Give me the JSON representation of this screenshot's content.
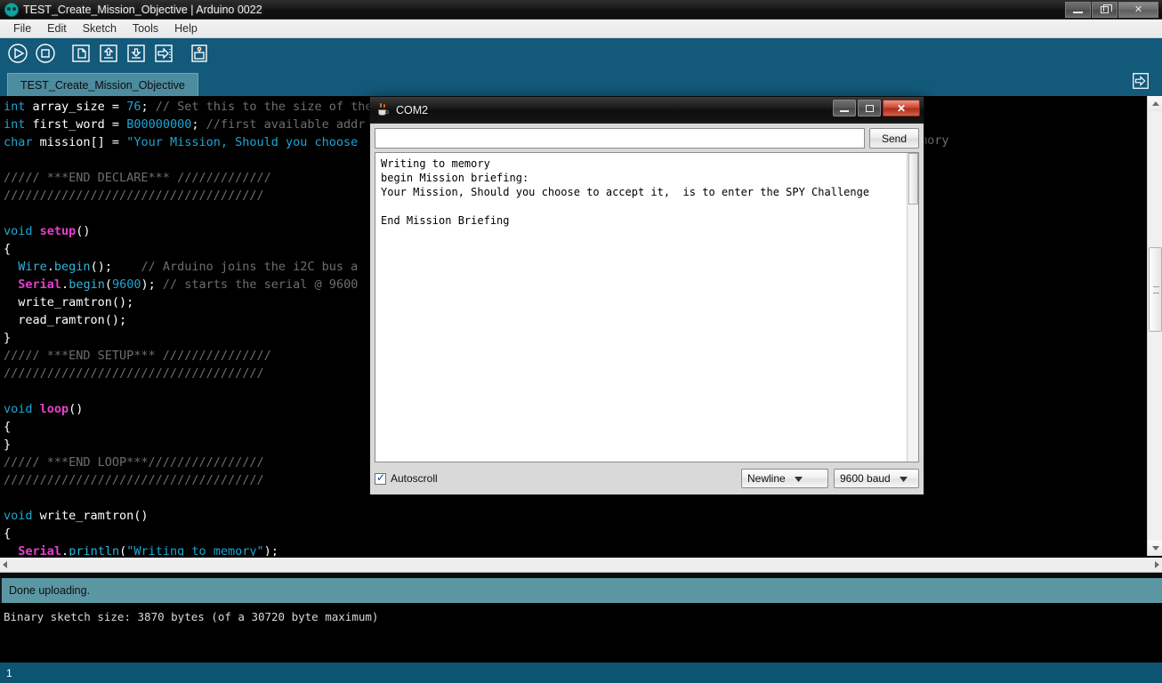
{
  "window": {
    "title": "TEST_Create_Mission_Objective | Arduino 0022",
    "icon": "arduino-logo-icon",
    "controls": {
      "minimize": "minimize-icon",
      "restore": "restore-icon",
      "close": "close-icon"
    }
  },
  "menubar": {
    "items": [
      {
        "label": "File"
      },
      {
        "label": "Edit"
      },
      {
        "label": "Sketch"
      },
      {
        "label": "Tools"
      },
      {
        "label": "Help"
      }
    ]
  },
  "toolbar": {
    "buttons": [
      {
        "name": "verify-button",
        "icon": "play-icon",
        "label": "Verify"
      },
      {
        "name": "stop-button",
        "icon": "stop-icon",
        "label": "Stop"
      },
      {
        "name": "new-button",
        "icon": "new-file-icon",
        "label": "New"
      },
      {
        "name": "open-button",
        "icon": "open-up-arrow-icon",
        "label": "Open"
      },
      {
        "name": "save-button",
        "icon": "save-down-arrow-icon",
        "label": "Save"
      },
      {
        "name": "upload-button",
        "icon": "upload-right-arrow-icon",
        "label": "Upload"
      },
      {
        "name": "serial-monitor-button",
        "icon": "serial-monitor-icon",
        "label": "Serial Monitor"
      }
    ],
    "tab_menu_icon": "tab-menu-arrow-icon"
  },
  "tabs": {
    "active": "TEST_Create_Mission_Objective"
  },
  "editor": {
    "lines": [
      {
        "tokens": [
          {
            "t": "int",
            "c": "kw"
          },
          {
            "t": " array_size = ",
            "c": "plain"
          },
          {
            "t": "76",
            "c": "num"
          },
          {
            "t": "; ",
            "c": "plain"
          },
          {
            "t": "// Set this to the size of the",
            "c": "cmt"
          }
        ]
      },
      {
        "tokens": [
          {
            "t": "int",
            "c": "kw"
          },
          {
            "t": " first_word = ",
            "c": "plain"
          },
          {
            "t": "B00000000",
            "c": "num"
          },
          {
            "t": "; ",
            "c": "plain"
          },
          {
            "t": "//first available addr",
            "c": "cmt"
          }
        ]
      },
      {
        "tokens": [
          {
            "t": "char",
            "c": "kw"
          },
          {
            "t": " mission[] = ",
            "c": "plain"
          },
          {
            "t": "\"Your Mission, Should you choose",
            "c": "str"
          }
        ]
      },
      {
        "tokens": []
      },
      {
        "tokens": [
          {
            "t": "///// ***END DECLARE*** /////////////",
            "c": "cmt"
          }
        ]
      },
      {
        "tokens": [
          {
            "t": "////////////////////////////////////",
            "c": "cmt"
          }
        ]
      },
      {
        "tokens": []
      },
      {
        "tokens": [
          {
            "t": "void",
            "c": "kw"
          },
          {
            "t": " ",
            "c": "plain"
          },
          {
            "t": "setup",
            "c": "fn"
          },
          {
            "t": "()",
            "c": "plain"
          }
        ]
      },
      {
        "tokens": [
          {
            "t": "{",
            "c": "plain"
          }
        ]
      },
      {
        "tokens": [
          {
            "t": "  ",
            "c": "plain"
          },
          {
            "t": "Wire",
            "c": "lib"
          },
          {
            "t": ".",
            "c": "plain"
          },
          {
            "t": "begin",
            "c": "lib"
          },
          {
            "t": "();    ",
            "c": "plain"
          },
          {
            "t": "// Arduino joins the i2C bus a",
            "c": "cmt"
          }
        ]
      },
      {
        "tokens": [
          {
            "t": "  ",
            "c": "plain"
          },
          {
            "t": "Serial",
            "c": "fn"
          },
          {
            "t": ".",
            "c": "plain"
          },
          {
            "t": "begin",
            "c": "lib"
          },
          {
            "t": "(",
            "c": "plain"
          },
          {
            "t": "9600",
            "c": "num"
          },
          {
            "t": "); ",
            "c": "plain"
          },
          {
            "t": "// starts the serial @ 9600 ",
            "c": "cmt"
          }
        ]
      },
      {
        "tokens": [
          {
            "t": "  write_ramtron();",
            "c": "plain"
          }
        ]
      },
      {
        "tokens": [
          {
            "t": "  read_ramtron();",
            "c": "plain"
          }
        ]
      },
      {
        "tokens": [
          {
            "t": "}",
            "c": "plain"
          }
        ]
      },
      {
        "tokens": [
          {
            "t": "///// ***END SETUP*** ///////////////",
            "c": "cmt"
          }
        ]
      },
      {
        "tokens": [
          {
            "t": "////////////////////////////////////",
            "c": "cmt"
          }
        ]
      },
      {
        "tokens": []
      },
      {
        "tokens": [
          {
            "t": "void",
            "c": "kw"
          },
          {
            "t": " ",
            "c": "plain"
          },
          {
            "t": "loop",
            "c": "fn"
          },
          {
            "t": "()",
            "c": "plain"
          }
        ]
      },
      {
        "tokens": [
          {
            "t": "{",
            "c": "plain"
          }
        ]
      },
      {
        "tokens": [
          {
            "t": "}",
            "c": "plain"
          }
        ]
      },
      {
        "tokens": [
          {
            "t": "///// ***END LOOP***////////////////",
            "c": "cmt"
          }
        ]
      },
      {
        "tokens": [
          {
            "t": "////////////////////////////////////",
            "c": "cmt"
          }
        ]
      },
      {
        "tokens": []
      },
      {
        "tokens": [
          {
            "t": "void",
            "c": "kw"
          },
          {
            "t": " write_ramtron()",
            "c": "plain"
          }
        ]
      },
      {
        "tokens": [
          {
            "t": "{",
            "c": "plain"
          }
        ]
      },
      {
        "tokens": [
          {
            "t": "  ",
            "c": "plain"
          },
          {
            "t": "Serial",
            "c": "fn"
          },
          {
            "t": ".",
            "c": "plain"
          },
          {
            "t": "println",
            "c": "lib"
          },
          {
            "t": "(",
            "c": "plain"
          },
          {
            "t": "\"Writing to memory\"",
            "c": "str"
          },
          {
            "t": ");",
            "c": "plain"
          }
        ]
      }
    ],
    "overflow_fragment": "mory"
  },
  "serial_monitor": {
    "title": "COM2",
    "icon": "java-coffee-cup-icon",
    "input_value": "",
    "input_placeholder": "",
    "send_label": "Send",
    "output": "Writing to memory\nbegin Mission briefing:\nYour Mission, Should you choose to accept it,  is to enter the SPY Challenge\n\nEnd Mission Briefing",
    "autoscroll_label": "Autoscroll",
    "autoscroll_checked": true,
    "line_ending": "Newline",
    "baud_rate": "9600 baud",
    "controls": {
      "minimize": "minimize-icon",
      "maximize": "maximize-icon",
      "close": "close-icon"
    }
  },
  "status": {
    "message": "Done uploading.",
    "console": "Binary sketch size: 3870 bytes (of a 30720 byte maximum)",
    "line_number": "1"
  },
  "colors": {
    "toolbar_blue": "#12597a",
    "status_teal": "#5b97a3",
    "linebar_blue": "#0d5472",
    "tab_active": "#4d8b9e",
    "keyword": "#1ba6d4",
    "function": "#e83fd0",
    "comment": "#6e6e6e"
  }
}
